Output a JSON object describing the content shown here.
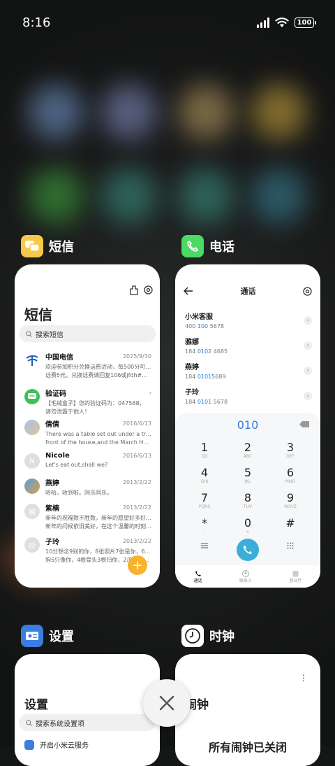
{
  "status": {
    "time": "8:16",
    "battery": "100"
  },
  "cards": {
    "sms": {
      "app_name": "短信",
      "title": "短信",
      "search_placeholder": "搜索短信",
      "messages": [
        {
          "name": "中国电信",
          "date": "2025/9/30",
          "text1": "欢迎参加积分兑换话费活动，每500分可兑换",
          "text2": "话费5元。兑换话费请回复106或jfdh#话费..."
        },
        {
          "name": "验证码",
          "date": "",
          "text1": "【毛绒盒子】您的验证码为：047588，",
          "text2": "请勿泄露于他人！"
        },
        {
          "name": "倩倩",
          "date": "2016/6/13",
          "text1": "There was a table set out under a tree in",
          "text2": "front of the house,and the March Hare an..."
        },
        {
          "name": "Nicole",
          "date": "2016/6/13",
          "text1": "Let's eat out,shall we?",
          "text2": ""
        },
        {
          "name": "燕婷",
          "date": "2013/2/22",
          "text1": "哈哈。收到啦。同乐同乐。",
          "text2": ""
        },
        {
          "name": "紫楠",
          "date": "2013/2/22",
          "text1": "新年的祝福数不胜数，新年的愿望好多好多，",
          "text2": "新年的问候依旧美好，在这个温馨的时刻，..."
        },
        {
          "name": "子玲",
          "date": "2013/2/22",
          "text1": "10分想念9别的你，8张照片7张是你，6只小",
          "text2": "狗5只像你，4根骨头3根归你，2爪着地1..."
        }
      ],
      "avatar_initials": {
        "nicole": "N",
        "zinan": "楠",
        "ziling": "玲"
      },
      "fab": "+"
    },
    "phone": {
      "app_name": "电话",
      "title": "通话",
      "contacts": [
        {
          "name": "小米客服",
          "pre": "400 ",
          "hl": "100",
          "post": " 5678"
        },
        {
          "name": "雅娜",
          "pre": "184 ",
          "hl": "0102",
          "post": " 4685"
        },
        {
          "name": "燕婷",
          "pre": "184 ",
          "hl": "01015",
          "post": "689"
        },
        {
          "name": "子玲",
          "pre": "184 ",
          "hl": "0101",
          "post": " 5678"
        }
      ],
      "dial_number": "010",
      "keys": [
        {
          "d": "1",
          "l": "QD"
        },
        {
          "d": "2",
          "l": "ABC"
        },
        {
          "d": "3",
          "l": "DEF"
        },
        {
          "d": "4",
          "l": "GHI"
        },
        {
          "d": "5",
          "l": "JKL"
        },
        {
          "d": "6",
          "l": "MNO"
        },
        {
          "d": "7",
          "l": "PQRS"
        },
        {
          "d": "8",
          "l": "TUV"
        },
        {
          "d": "9",
          "l": "WXYZ"
        },
        {
          "d": "*",
          "l": ","
        },
        {
          "d": "0",
          "l": "+"
        },
        {
          "d": "#",
          "l": ""
        }
      ],
      "nav": [
        "通话",
        "联系人",
        "营业厅"
      ]
    },
    "settings": {
      "app_name": "设置",
      "title": "设置",
      "search_placeholder": "搜索系统设置项",
      "first_item": "开启小米云服务"
    },
    "clock": {
      "app_name": "时钟",
      "title": "闹钟",
      "status_text": "所有闹钟已关闭"
    }
  },
  "colors": {
    "sms_icon": "#f7c948",
    "phone_icon": "#4cd964",
    "settings_icon": "#3b7de0",
    "accent_blue": "#2f7ed8",
    "fab": "#f7b32e"
  }
}
